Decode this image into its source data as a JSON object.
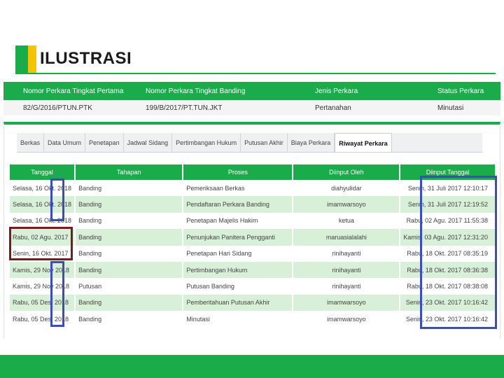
{
  "slide": {
    "title": "ILUSTRASI"
  },
  "case": {
    "headers": [
      "Nomor Perkara Tingkat Pertama",
      "Nomor Perkara Tingkat Banding",
      "Jenis Perkara",
      "Status Perkara"
    ],
    "values": [
      "82/G/2016/PTUN.PTK",
      "199/B/2017/PT.TUN.JKT",
      "Pertanahan",
      "Minutasi"
    ]
  },
  "tabs": [
    {
      "label": "Berkas",
      "active": false
    },
    {
      "label": "Data Umum",
      "active": false
    },
    {
      "label": "Penetapan",
      "active": false
    },
    {
      "label": "Jadwal Sidang",
      "active": false
    },
    {
      "label": "Pertimbangan Hukum",
      "active": false
    },
    {
      "label": "Putusan Akhir",
      "active": false
    },
    {
      "label": "Biaya Perkara",
      "active": false
    },
    {
      "label": "Riwayat Perkara",
      "active": true
    }
  ],
  "history": {
    "headers": [
      "Tanggal",
      "Tahapan",
      "Proses",
      "Diinput Oleh",
      "Diinput Tanggal"
    ],
    "rows": [
      [
        "Selasa, 16 Okt. 2018",
        "Banding",
        "Pemeriksaan Berkas",
        "diahyulidar",
        "Senin, 31 Juli 2017 12:10:17"
      ],
      [
        "Selasa, 16 Okt. 2018",
        "Banding",
        "Pendaftaran Perkara Banding",
        "imamwarsoyo",
        "Senin, 31 Juli 2017 12:19:52"
      ],
      [
        "Selasa, 16 Okt. 2018",
        "Banding",
        "Penetapan Majelis Hakim",
        "ketua",
        "Rabu, 02 Agu. 2017 11:55:38"
      ],
      [
        "Rabu, 02 Agu. 2017",
        "Banding",
        "Penunjukan Panitera Pengganti",
        "maruasialalahi",
        "Kamis, 03 Agu. 2017 12:31:20"
      ],
      [
        "Senin, 16 Okt. 2017",
        "Banding",
        "Penetapan Hari Sidang",
        "rinihayanti",
        "Rabu, 18 Okt. 2017 08:35:19"
      ],
      [
        "Kamis, 29 Nov 2018",
        "Banding",
        "Pertimbangan Hukum",
        "rinihayanti",
        "Rabu, 18 Okt. 2017 08:36:38"
      ],
      [
        "Kamis, 29 Nov 2018",
        "Putusan",
        "Putusan Banding",
        "rinihayanti",
        "Rabu, 18 Okt. 2017 08:38:08"
      ],
      [
        "Rabu, 05 Des. 2018",
        "Banding",
        "Pemberitahuan Putusan Akhir",
        "imamwarsoyo",
        "Senin, 23 Okt. 2017 10:16:42"
      ],
      [
        "Rabu, 05 Des. 2018",
        "Banding",
        "Minutasi",
        "imamwarsoyo",
        "Senin, 23 Okt. 2017 10:16:42"
      ]
    ]
  },
  "colors": {
    "accent": "#1aab4b",
    "yellow": "#f5c400",
    "highlight_blue": "#3d4db8",
    "highlight_red": "#7b1a1a",
    "row_alt": "#d8efd8"
  }
}
